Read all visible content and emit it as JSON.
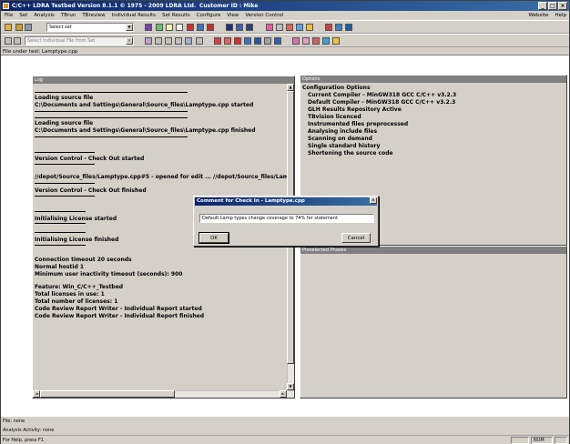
{
  "window": {
    "title": "C/C++ LDRA Testbed Version 8.1.1 © 1975 - 2009 LDRA Ltd.",
    "customer": "Customer ID : Mike"
  },
  "menu": {
    "items": [
      "File",
      "Set",
      "Analysis",
      "TBrun",
      "TBreview",
      "Individual Results",
      "Set Results",
      "Configure",
      "View",
      "Version Control"
    ],
    "right_items": [
      "Website",
      "Help"
    ]
  },
  "toolbar": {
    "set_select": "Select set",
    "file_select": "Select Individual File from Set"
  },
  "file_under_test": "File under test: Lamptype.cpp",
  "log": {
    "title": "Log",
    "lines": [
      "Loading source file",
      "C:\\Documents and Settings\\General\\Source_files\\Lamptype.cpp started",
      "Loading source file",
      "C:\\Documents and Settings\\General\\Source_files\\Lamptype.cpp finished",
      "Version Control - Check Out started",
      "//depot/Source_files/Lamptype.cpp#5 - opened for edit ... //depot/Source_files/Lamp",
      "Version Control - Check Out finished",
      "Initialising License started",
      "Initialising License finished",
      "Connection timeout 20 seconds",
      "Normal hostid 1",
      "Minimum user inactivity timeout (seconds): 900",
      "Feature: Win_C/C++_Testbed",
      "Total licenses in use: 1",
      "Total number of licenses: 1",
      "Code Review Report Writer - Individual Report started",
      "Code Review Report Writer - Individual Report finished"
    ]
  },
  "options": {
    "title": "Options",
    "lines": [
      "Configuration Options",
      "Current Compiler - MinGW318 GCC C/C++ v3.2.3",
      "Default Compiler - MinGW318 GCC C/C++ v3.2.3",
      "GLH Results Repository Active",
      "TBvision licenced",
      "Instrumented files preprocessed",
      "Analysing include files",
      "Scanning on demand",
      "Single standard history",
      "Shortening the source code"
    ]
  },
  "phases": {
    "title": "Preselected Phases"
  },
  "dialog": {
    "title": "Comment for Check In - Lamptype.cpp",
    "comment": "Default Lamp types change coverage to 74% for statement",
    "ok": "OK",
    "cancel": "Cancel",
    "close": "x"
  },
  "status": {
    "file": "File: none",
    "activity": "Analysis Activity: none",
    "help": "For Help, press F1",
    "num": "NUM"
  },
  "icons": [
    "open-icon",
    "save-icon",
    "analyse-icon",
    "report-icon",
    "flowgraph-icon",
    "callgraph-icon",
    "stop-icon"
  ]
}
